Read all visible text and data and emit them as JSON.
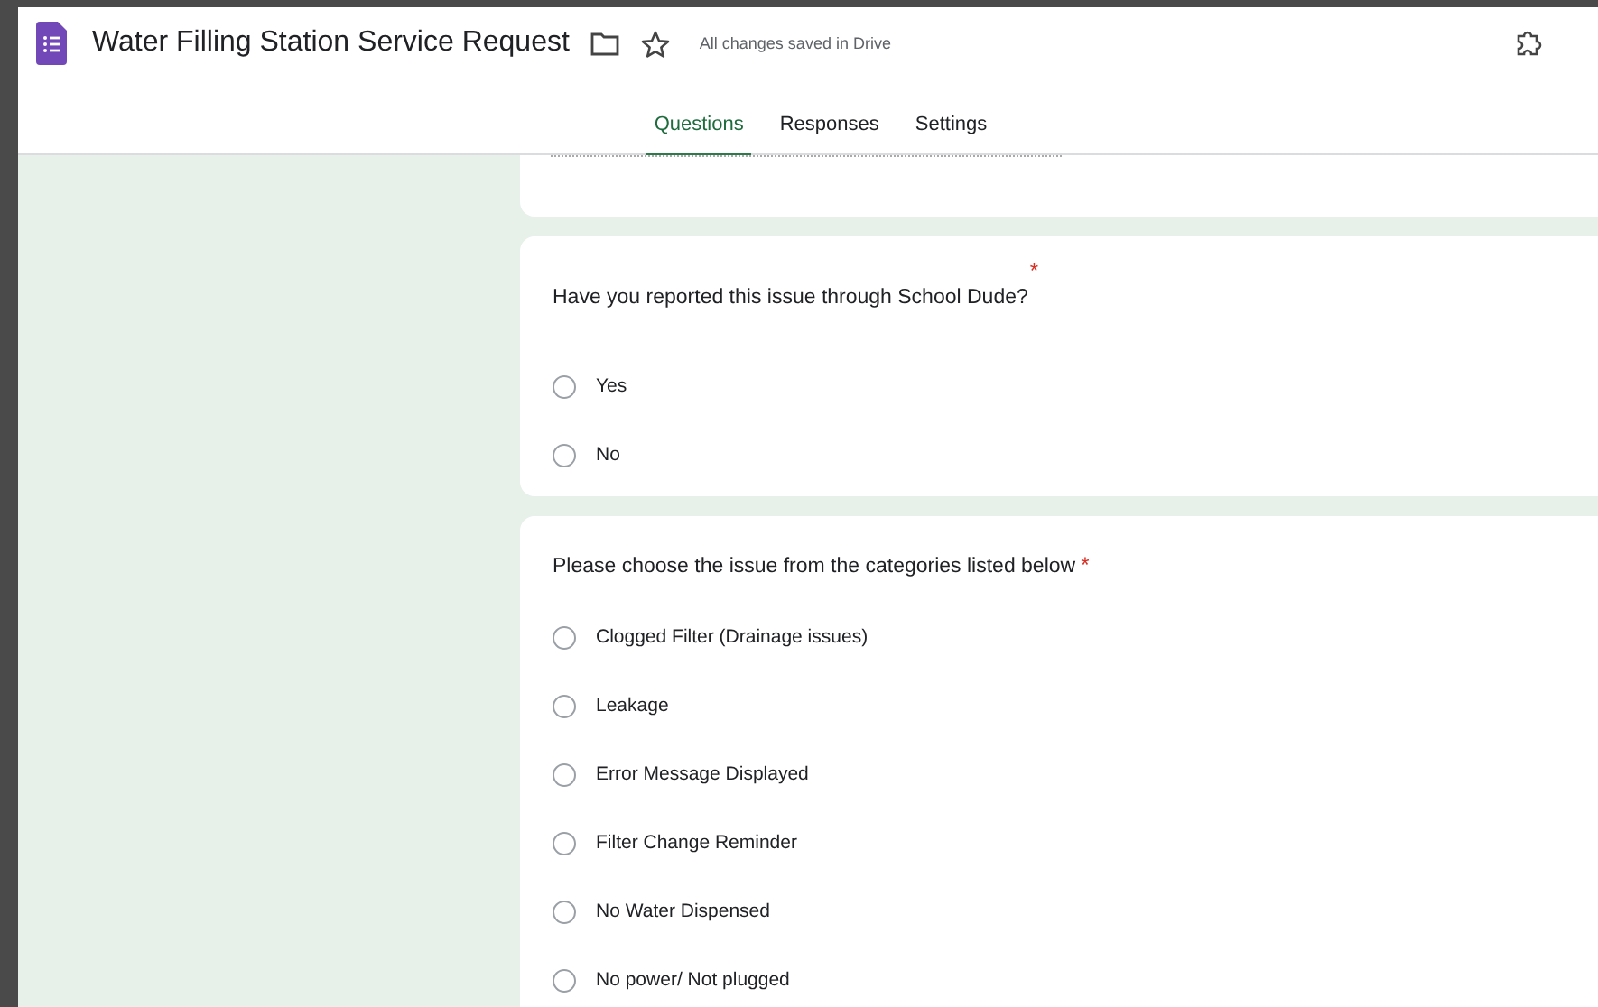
{
  "header": {
    "title": "Water Filling Station Service Request",
    "save_status": "All changes saved in Drive"
  },
  "tabs": [
    {
      "label": "Questions",
      "selected": true
    },
    {
      "label": "Responses",
      "selected": false
    },
    {
      "label": "Settings",
      "selected": false
    }
  ],
  "questions": [
    {
      "text": "Have you reported this issue through School Dude?",
      "required_mark": "*",
      "options": [
        {
          "label": "Yes",
          "selected": false
        },
        {
          "label": "No",
          "selected": false
        }
      ]
    },
    {
      "text": "Please choose the issue from the categories listed below",
      "required_mark": "*",
      "options": [
        {
          "label": "Clogged Filter (Drainage issues)",
          "selected": false
        },
        {
          "label": "Leakage",
          "selected": false
        },
        {
          "label": "Error Message Displayed",
          "selected": false
        },
        {
          "label": "Filter Change Reminder",
          "selected": false
        },
        {
          "label": "No Water Dispensed",
          "selected": false
        },
        {
          "label": "No power/ Not plugged",
          "selected": false
        }
      ]
    }
  ]
}
